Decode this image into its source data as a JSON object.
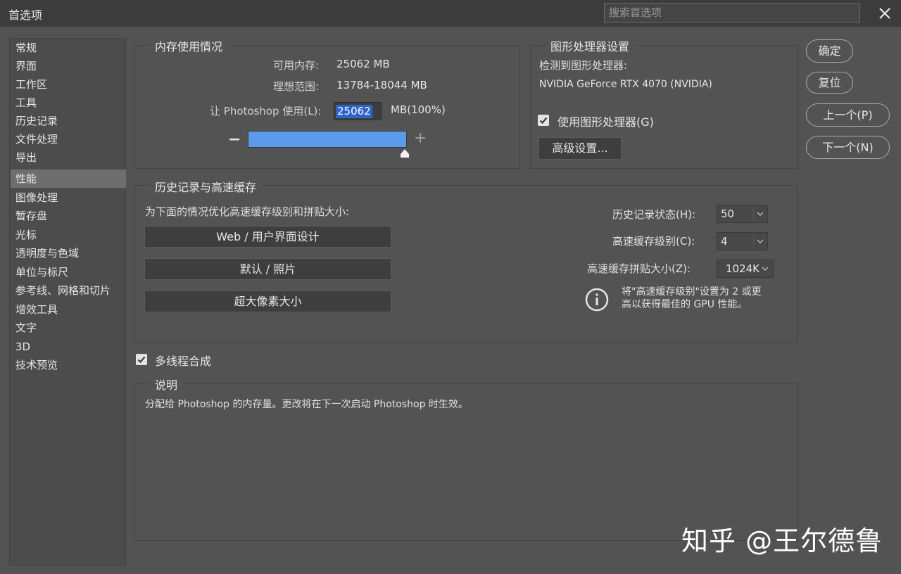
{
  "window": {
    "title": "首选项",
    "search_placeholder": "搜索首选项"
  },
  "sidebar": {
    "items": [
      {
        "label": "常规"
      },
      {
        "label": "界面"
      },
      {
        "label": "工作区"
      },
      {
        "label": "工具"
      },
      {
        "label": "历史记录"
      },
      {
        "label": "文件处理"
      },
      {
        "label": "导出"
      },
      {
        "label": "性能"
      },
      {
        "label": "图像处理"
      },
      {
        "label": "暂存盘"
      },
      {
        "label": "光标"
      },
      {
        "label": "透明度与色域"
      },
      {
        "label": "单位与标尺"
      },
      {
        "label": "参考线、网格和切片"
      },
      {
        "label": "增效工具"
      },
      {
        "label": "文字"
      },
      {
        "label": "3D"
      },
      {
        "label": "技术预览"
      }
    ],
    "active": "性能"
  },
  "memory": {
    "legend": "内存使用情况",
    "available_label": "可用内存:",
    "available_value": "25062 MB",
    "ideal_label": "理想范围:",
    "ideal_value": "13784-18044 MB",
    "let_label": "让 Photoshop 使用(L):",
    "input_value": "25062",
    "unit": "MB(100%)",
    "slider_level": 1.0,
    "minus": "−",
    "plus": "+"
  },
  "gpu": {
    "legend": "图形处理器设置",
    "detected_label": "检测到图形处理器:",
    "gpu_name": "NVIDIA GeForce RTX 4070 (NVIDIA)",
    "use_gpu_label": "使用图形处理器(G)",
    "use_gpu_checked": true,
    "advanced_button": "高级设置..."
  },
  "buttons": {
    "ok": "确定",
    "reset": "复位",
    "prev": "上一个(P)",
    "next": "下一个(N)"
  },
  "history_cache": {
    "legend": "历史记录与高速缓存",
    "optimize_text": "为下面的情况优化高速缓存级别和拼贴大小:",
    "preset_buttons": [
      "Web / 用户界面设计",
      "默认 / 照片",
      "超大像素大小"
    ],
    "history_states_label": "历史记录状态(H):",
    "history_states_value": "50",
    "cache_levels_label": "高速缓存级别(C):",
    "cache_levels_value": "4",
    "tile_size_label": "高速缓存拼贴大小(Z):",
    "tile_size_value": "1024K",
    "info_text_line1": "将\"高速缓存级别\"设置为 2 或更",
    "info_text_line2": "高以获得最佳的 GPU 性能。"
  },
  "multithread": {
    "label": "多线程合成",
    "checked": true
  },
  "description": {
    "legend": "说明",
    "text": "分配给 Photoshop 的内存量。更改将在下一次启动 Photoshop 时生效。"
  },
  "watermark": "知乎 @王尔德鲁",
  "colors": {
    "accent_blue": "#5b9bea",
    "selection_blue": "#2f63c8",
    "background": "#535353"
  }
}
